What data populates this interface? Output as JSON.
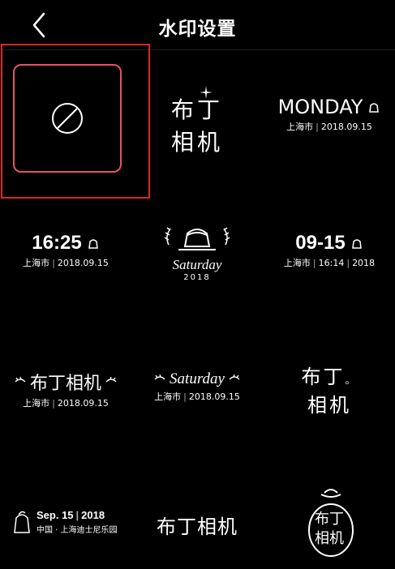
{
  "header": {
    "title": "水印设置",
    "back_icon": "chevron-left-icon"
  },
  "watermarks": {
    "w2": {
      "l1": "布丁",
      "l2": "相机"
    },
    "w3": {
      "day": "MONDAY",
      "city": "上海市",
      "date": "2018.09.15"
    },
    "w4": {
      "time": "16:25",
      "city": "上海市",
      "date": "2018.09.15"
    },
    "w5": {
      "day": "Saturday",
      "year": "2018"
    },
    "w6": {
      "date": "09-15",
      "city": "上海市",
      "time": "16:14",
      "year": "2018"
    },
    "w7": {
      "name": "布丁相机",
      "city": "上海市",
      "date": "2018.09.15"
    },
    "w8": {
      "day": "Saturday",
      "city": "上海市",
      "date": "2018.09.15"
    },
    "w9": {
      "l1": "布丁",
      "l2": "相机"
    },
    "w10": {
      "date": "Sep. 15",
      "year": "2018",
      "country": "中国",
      "place": "上海迪士尼乐园"
    },
    "w11": {
      "name": "布丁相机"
    },
    "w12": {
      "l1": "布丁",
      "l2": "相机"
    }
  }
}
